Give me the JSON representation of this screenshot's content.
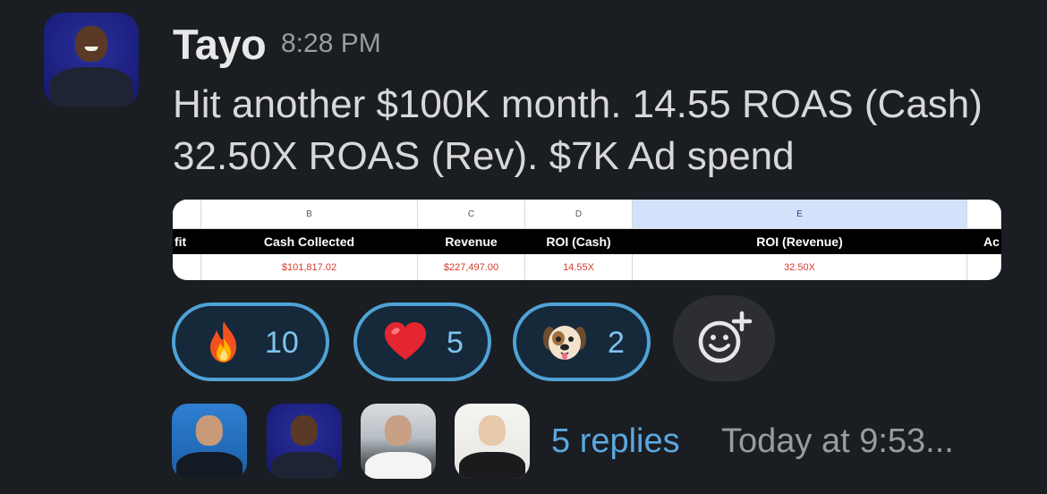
{
  "message": {
    "author": "Tayo",
    "time": "8:28 PM",
    "text": "Hit another $100K month. 14.55 ROAS (Cash) 32.50X ROAS (Rev). $7K Ad spend"
  },
  "attachment": {
    "column_letters": [
      "",
      "B",
      "C",
      "D",
      "E",
      ""
    ],
    "headers": [
      "fit",
      "Cash Collected",
      "Revenue",
      "ROI (Cash)",
      "ROI (Revenue)",
      "Ac"
    ],
    "values": [
      "",
      "$101,817.02",
      "$227,497.00",
      "14.55X",
      "32.50X",
      ""
    ],
    "selected_column": "E"
  },
  "reactions": [
    {
      "emoji": "fire",
      "count": "10"
    },
    {
      "emoji": "heart",
      "count": "5"
    },
    {
      "emoji": "dog",
      "count": "2"
    }
  ],
  "thread": {
    "replies": "5 replies",
    "last_reply": "Today at 9:53..."
  },
  "colors": {
    "background": "#1a1d21",
    "reaction_border": "#4fa3d6",
    "reply_link": "#5aa8e0",
    "sheet_value_red": "#d33b2c"
  }
}
